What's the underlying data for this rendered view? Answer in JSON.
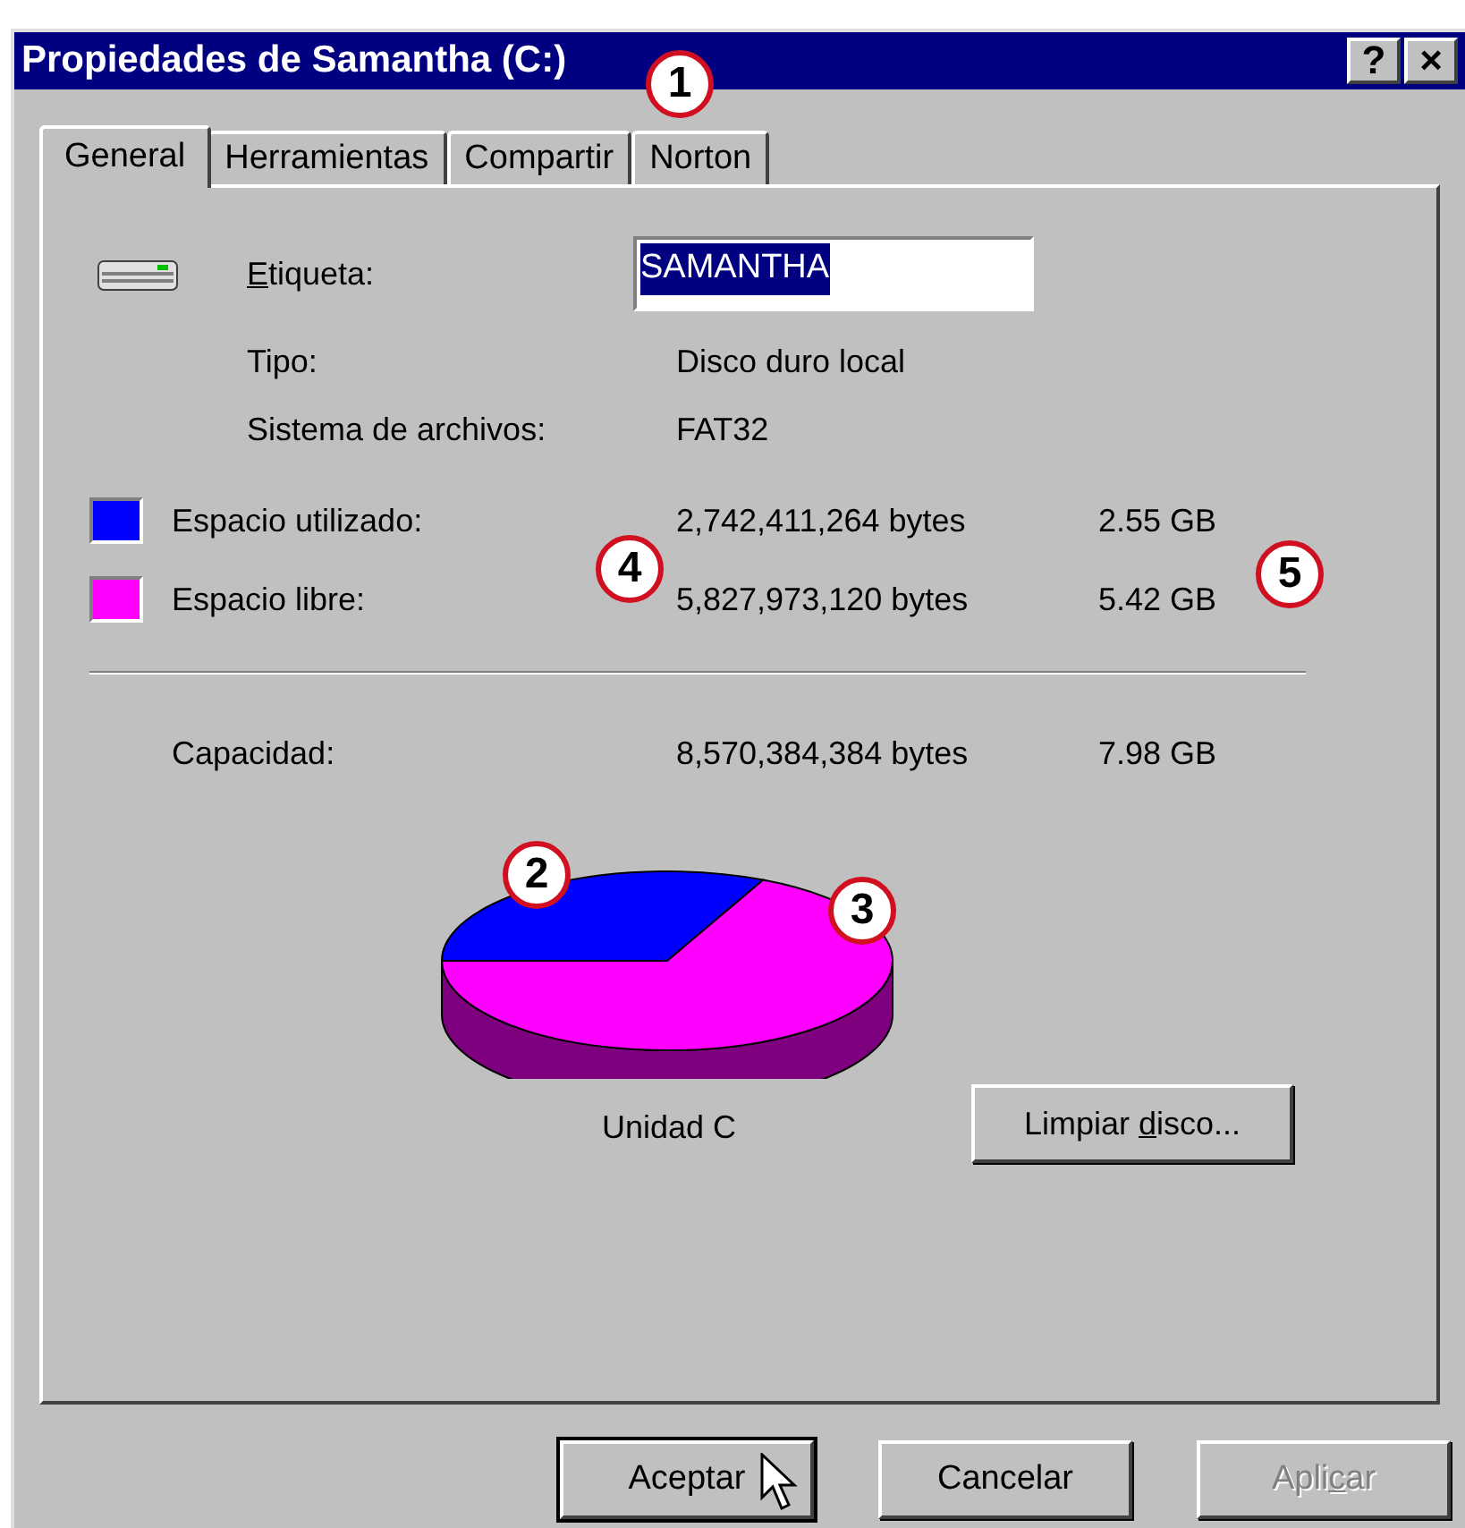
{
  "window": {
    "title": "Propiedades de Samantha (C:)",
    "title_buttons": [
      {
        "label": "?"
      },
      {
        "label": "×"
      }
    ]
  },
  "tabs": [
    {
      "label": "General",
      "selected": true
    },
    {
      "label": "Herramientas",
      "selected": false
    },
    {
      "label": "Compartir",
      "selected": false
    },
    {
      "label": "Norton",
      "selected": false
    }
  ],
  "label_field": {
    "label_parts": [
      {
        "text": "E",
        "underline": true
      },
      {
        "text": "tiqueta:",
        "underline": false
      }
    ],
    "value": "SAMANTHA"
  },
  "info": [
    {
      "label": "Tipo:",
      "value": "Disco duro local"
    },
    {
      "label": "Sistema de archivos:",
      "value": "FAT32"
    }
  ],
  "space": [
    {
      "label": "Espacio utilizado:",
      "bytes": "2,742,411,264 bytes",
      "size": "2.55 GB",
      "color": "#0000ff"
    },
    {
      "label": "Espacio libre:",
      "bytes": "5,827,973,120 bytes",
      "size": "5.42 GB",
      "color": "#ff00ff"
    }
  ],
  "capacity": {
    "label": "Capacidad:",
    "bytes": "8,570,384,384 bytes",
    "size": "7.98 GB"
  },
  "chart": {
    "caption": "Unidad C"
  },
  "cleanup_button": {
    "label_parts": [
      {
        "text": "Limpiar ",
        "underline": false
      },
      {
        "text": "d",
        "underline": true
      },
      {
        "text": "isco...",
        "underline": false
      }
    ]
  },
  "buttons": [
    {
      "label_parts": [
        {
          "text": "Aceptar",
          "underline": false
        }
      ],
      "default": true,
      "disabled": false
    },
    {
      "label_parts": [
        {
          "text": "Cancelar",
          "underline": false
        }
      ],
      "default": false,
      "disabled": false
    },
    {
      "label_parts": [
        {
          "text": "Apli",
          "underline": false
        },
        {
          "text": "c",
          "underline": true
        },
        {
          "text": "ar",
          "underline": false
        }
      ],
      "default": false,
      "disabled": true
    }
  ],
  "callouts": [
    {
      "label": "1"
    },
    {
      "label": "2"
    },
    {
      "label": "3"
    },
    {
      "label": "4"
    },
    {
      "label": "5"
    }
  ]
}
